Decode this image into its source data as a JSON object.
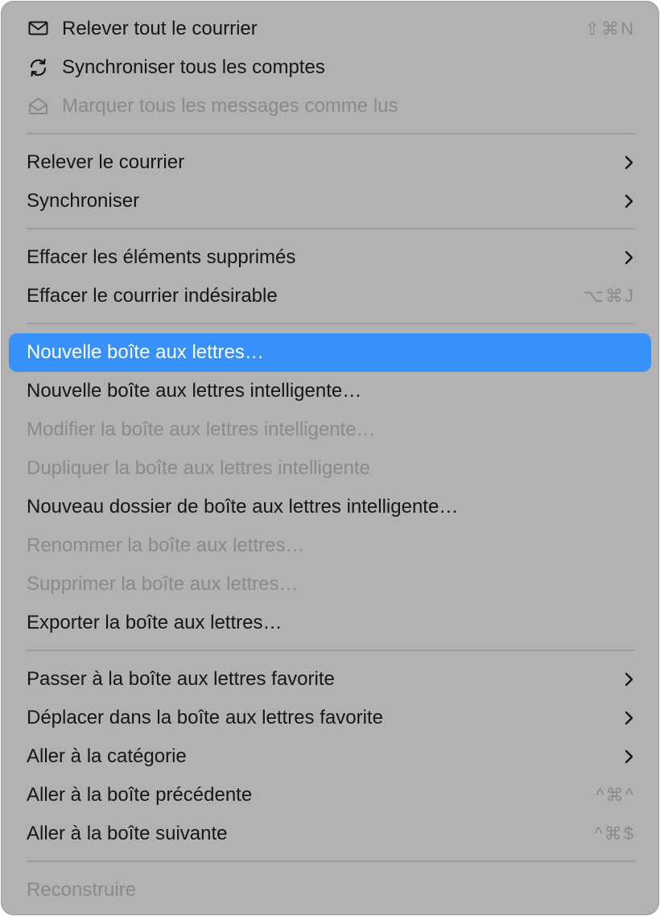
{
  "menu": {
    "get_all_mail": {
      "label": "Relever tout le courrier",
      "shortcut": "⇧⌘N",
      "icon": "envelope-icon"
    },
    "sync_all_accounts": {
      "label": "Synchroniser tous les comptes",
      "icon": "sync-icon"
    },
    "mark_all_read": {
      "label": "Marquer tous les messages comme lus",
      "icon": "open-envelope-icon",
      "disabled": true
    },
    "get_mail": {
      "label": "Relever le courrier",
      "submenu": true
    },
    "synchronize": {
      "label": "Synchroniser",
      "submenu": true
    },
    "erase_deleted": {
      "label": "Effacer les éléments supprimés",
      "submenu": true
    },
    "erase_junk": {
      "label": "Effacer le courrier indésirable",
      "shortcut": "⌥⌘J"
    },
    "new_mailbox": {
      "label": "Nouvelle boîte aux lettres…",
      "highlighted": true
    },
    "new_smart_mailbox": {
      "label": "Nouvelle boîte aux lettres intelligente…"
    },
    "edit_smart_mailbox": {
      "label": "Modifier la boîte aux lettres intelligente…",
      "disabled": true
    },
    "duplicate_smart_mailbox": {
      "label": "Dupliquer la boîte aux lettres intelligente",
      "disabled": true
    },
    "new_smart_mailbox_folder": {
      "label": "Nouveau dossier de boîte aux lettres intelligente…"
    },
    "rename_mailbox": {
      "label": "Renommer la boîte aux lettres…",
      "disabled": true
    },
    "delete_mailbox": {
      "label": "Supprimer la boîte aux lettres…",
      "disabled": true
    },
    "export_mailbox": {
      "label": "Exporter la boîte aux lettres…"
    },
    "go_to_favorite": {
      "label": "Passer à la boîte aux lettres favorite",
      "submenu": true
    },
    "move_to_favorite": {
      "label": "Déplacer dans la boîte aux lettres favorite",
      "submenu": true
    },
    "go_to_category": {
      "label": "Aller à la catégorie",
      "submenu": true
    },
    "go_to_previous": {
      "label": "Aller à la boîte précédente",
      "shortcut": "^⌘^"
    },
    "go_to_next": {
      "label": "Aller à la boîte suivante",
      "shortcut": "^⌘$"
    },
    "rebuild": {
      "label": "Reconstruire",
      "disabled": true
    }
  },
  "colors": {
    "menu_background": "#b2b2b2",
    "highlight": "#3691fb",
    "text": "#161616",
    "disabled_text": "#8a8a8a",
    "separator": "#9d9d9d"
  }
}
